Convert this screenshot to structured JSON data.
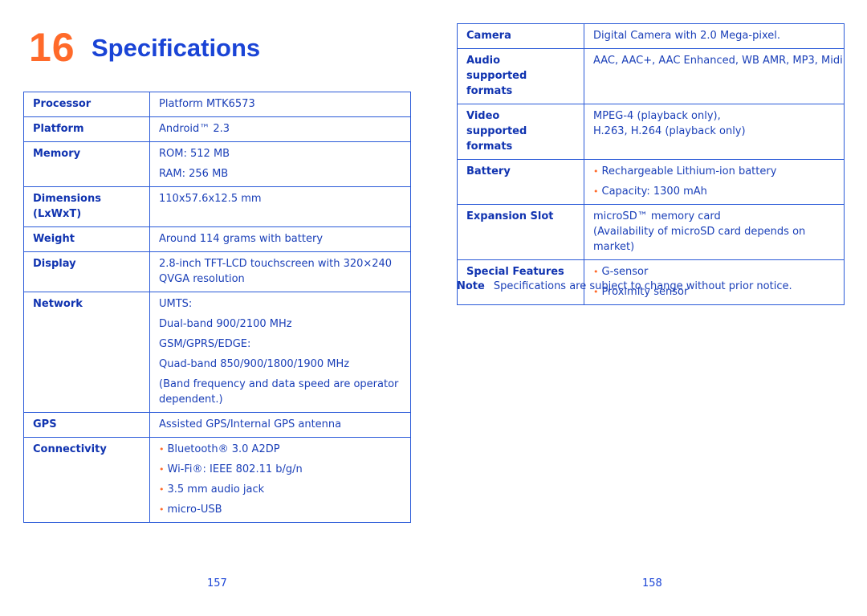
{
  "chapter": {
    "number": "16",
    "title": "Specifications"
  },
  "colors": {
    "chapter_number": "#ff6a2a",
    "heading": "#1a44d6",
    "text": "#1a3fb8",
    "border": "#2a5ad8",
    "bullet": "#ff6a2a"
  },
  "left_table": [
    {
      "key": "Processor",
      "lines": [
        "Platform MTK6573"
      ]
    },
    {
      "key": "Platform",
      "lines": [
        "Android™  2.3"
      ]
    },
    {
      "key": "Memory",
      "lines": [
        "ROM: 512 MB",
        "RAM: 256 MB"
      ]
    },
    {
      "key": "Dimensions (LxWxT)",
      "lines": [
        "110x57.6x12.5 mm"
      ]
    },
    {
      "key": "Weight",
      "lines": [
        "Around 114 grams with battery"
      ]
    },
    {
      "key": "Display",
      "lines": [
        "2.8-inch TFT-LCD touchscreen with 320×240 QVGA resolution"
      ]
    },
    {
      "key": "Network",
      "lines": [
        "UMTS:",
        "Dual-band 900/2100 MHz",
        "GSM/GPRS/EDGE:",
        "Quad-band 850/900/1800/1900 MHz",
        "(Band frequency and data speed are operator dependent.)"
      ]
    },
    {
      "key": "GPS",
      "lines": [
        "Assisted GPS/Internal GPS antenna"
      ]
    },
    {
      "key": "Connectivity",
      "bullets": [
        "Bluetooth® 3.0 A2DP",
        "Wi-Fi®: IEEE 802.11 b/g/n",
        "3.5 mm audio jack",
        "micro-USB"
      ]
    }
  ],
  "right_table": [
    {
      "key": "Camera",
      "lines": [
        "Digital Camera with 2.0 Mega-pixel."
      ]
    },
    {
      "key": "Audio supported formats",
      "lines": [
        "AAC, AAC+, AAC Enhanced, WB AMR, MP3, Midi"
      ]
    },
    {
      "key": "Video supported formats",
      "lines": [
        "MPEG-4 (playback only),",
        "H.263, H.264 (playback only)"
      ]
    },
    {
      "key": "Battery",
      "bullets": [
        "Rechargeable Lithium-ion battery",
        "Capacity: 1300 mAh"
      ]
    },
    {
      "key": "Expansion Slot",
      "lines": [
        "microSD™  memory card",
        "(Availability of microSD card depends on market)"
      ]
    },
    {
      "key": "Special Features",
      "bullets": [
        "G-sensor",
        "Proximity sensor"
      ]
    }
  ],
  "note": {
    "label": "Note",
    "text": "Specifications are subject to change without prior notice."
  },
  "pages": {
    "left": "157",
    "right": "158"
  }
}
